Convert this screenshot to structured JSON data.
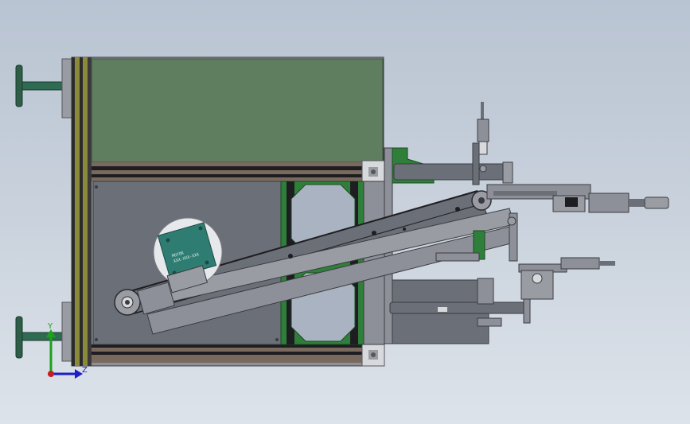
{
  "viewport": {
    "background_top": "#b9c4d2",
    "background_bottom": "#dde3ea"
  },
  "colors": {
    "green_panel": "#5f7d5f",
    "dark_gray_plate": "#6b6f78",
    "frame_gray": "#8d9098",
    "rail_brown": "#7a6a5e",
    "rail_black": "#1e1e22",
    "olive_strip": "#8a8a3a",
    "green_bracket": "#2f7f3a",
    "teal_motor": "#2f7d72",
    "axis_x": "#c81e1e",
    "axis_y": "#1ea01e",
    "axis_z": "#1e1ec8"
  },
  "triad": {
    "y_label": "Y",
    "z_label": "Z",
    "x_icon": "x-axis-arrow-icon",
    "y_icon": "y-axis-arrow-icon",
    "z_icon": "z-axis-arrow-icon"
  },
  "motor_label": {
    "line1": "MOTOR",
    "line2": "XXX-XXX-XXX"
  }
}
